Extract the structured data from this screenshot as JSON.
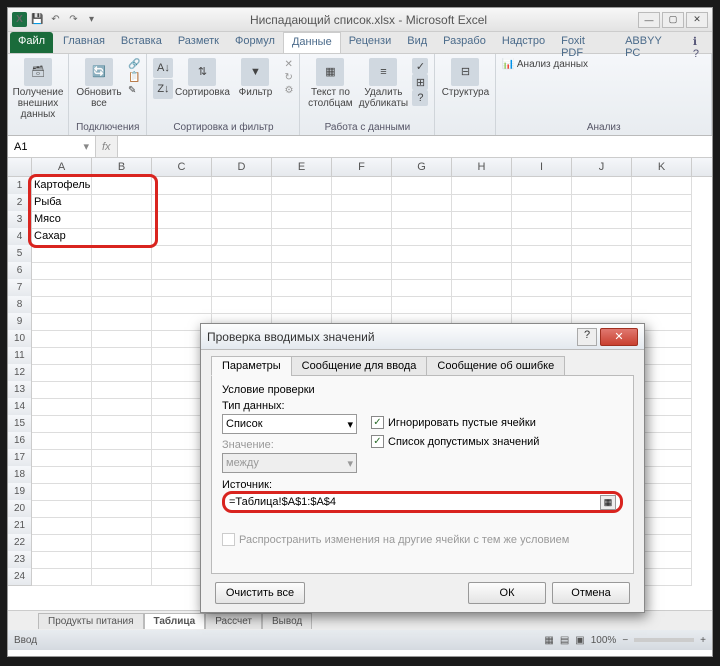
{
  "window": {
    "title": "Ниспадающий список.xlsx - Microsoft Excel",
    "docname": "Ниспадающий список.xlsx",
    "app": "Microsoft Excel"
  },
  "tabs": {
    "file": "Файл",
    "items": [
      "Главная",
      "Вставка",
      "Разметк",
      "Формул",
      "Данные",
      "Рецензи",
      "Вид",
      "Разрабо",
      "Надстро",
      "Foxit PDF",
      "ABBYY PC"
    ],
    "active": "Данные"
  },
  "ribbon": {
    "g1": {
      "btn": "Получение внешних данных",
      "label": ""
    },
    "g2": {
      "btn": "Обновить все",
      "label": "Подключения",
      "s1": "Подключения",
      "s2": "Свойства",
      "s3": "Изменить связи"
    },
    "g3": {
      "b1": "Сортировка",
      "b2": "Фильтр",
      "s1": "Очистить",
      "s2": "Повторить",
      "s3": "Дополнительно",
      "label": "Сортировка и фильтр"
    },
    "g4": {
      "b1": "Текст по столбцам",
      "b2": "Удалить дубликаты",
      "label": "Работа с данными"
    },
    "g5": {
      "b1": "Структура"
    },
    "g6": {
      "b1": "Анализ данных",
      "label": "Анализ"
    }
  },
  "formula": {
    "namebox": "A1",
    "fx": "fx",
    "value": ""
  },
  "columns": [
    "",
    "A",
    "B",
    "C",
    "D",
    "E",
    "F",
    "G",
    "H",
    "I",
    "J",
    "K"
  ],
  "cells": {
    "A1": "Картофель",
    "A2": "Рыба",
    "A3": "Мясо",
    "A4": "Сахар"
  },
  "rowCount": 24,
  "sheets": {
    "items": [
      "Продукты питания",
      "Таблица",
      "Рассчет",
      "Вывод"
    ],
    "active": "Таблица"
  },
  "statusbar": {
    "mode": "Ввод",
    "zoom": "100%"
  },
  "dialog": {
    "title": "Проверка вводимых значений",
    "tabs": [
      "Параметры",
      "Сообщение для ввода",
      "Сообщение об ошибке"
    ],
    "activeTab": "Параметры",
    "section": "Условие проверки",
    "dataTypeLabel": "Тип данных:",
    "dataType": "Список",
    "valueLabel": "Значение:",
    "valueSel": "между",
    "chk1": "Игнорировать пустые ячейки",
    "chk2": "Список допустимых значений",
    "sourceLabel": "Источник:",
    "source": "=Таблица!$A$1:$A$4",
    "applyChanges": "Распространить изменения на другие ячейки с тем же условием",
    "clearBtn": "Очистить все",
    "okBtn": "ОК",
    "cancelBtn": "Отмена"
  }
}
